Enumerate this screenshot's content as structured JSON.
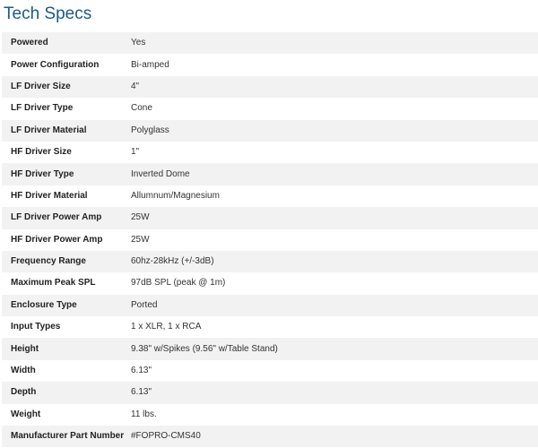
{
  "title": "Tech Specs",
  "specs": [
    {
      "label": "Powered",
      "value": "Yes"
    },
    {
      "label": "Power Configuration",
      "value": "Bi-amped"
    },
    {
      "label": "LF Driver Size",
      "value": "4\""
    },
    {
      "label": "LF Driver Type",
      "value": "Cone"
    },
    {
      "label": "LF Driver Material",
      "value": "Polyglass"
    },
    {
      "label": "HF Driver Size",
      "value": "1\""
    },
    {
      "label": "HF Driver Type",
      "value": "Inverted Dome"
    },
    {
      "label": "HF Driver Material",
      "value": "Allumnum/Magnesium"
    },
    {
      "label": "LF Driver Power Amp",
      "value": "25W"
    },
    {
      "label": "HF Driver Power Amp",
      "value": "25W"
    },
    {
      "label": "Frequency Range",
      "value": "60hz-28kHz (+/-3dB)"
    },
    {
      "label": "Maximum Peak SPL",
      "value": "97dB SPL (peak @ 1m)"
    },
    {
      "label": "Enclosure Type",
      "value": "Ported"
    },
    {
      "label": "Input Types",
      "value": "1 x XLR, 1 x RCA"
    },
    {
      "label": "Height",
      "value": "9.38\" w/Spikes (9.56\" w/Table Stand)"
    },
    {
      "label": "Width",
      "value": "6.13\""
    },
    {
      "label": "Depth",
      "value": "6.13\""
    },
    {
      "label": "Weight",
      "value": "11 lbs."
    },
    {
      "label": "Manufacturer Part Number",
      "value": "#FOPRO-CMS40"
    }
  ]
}
